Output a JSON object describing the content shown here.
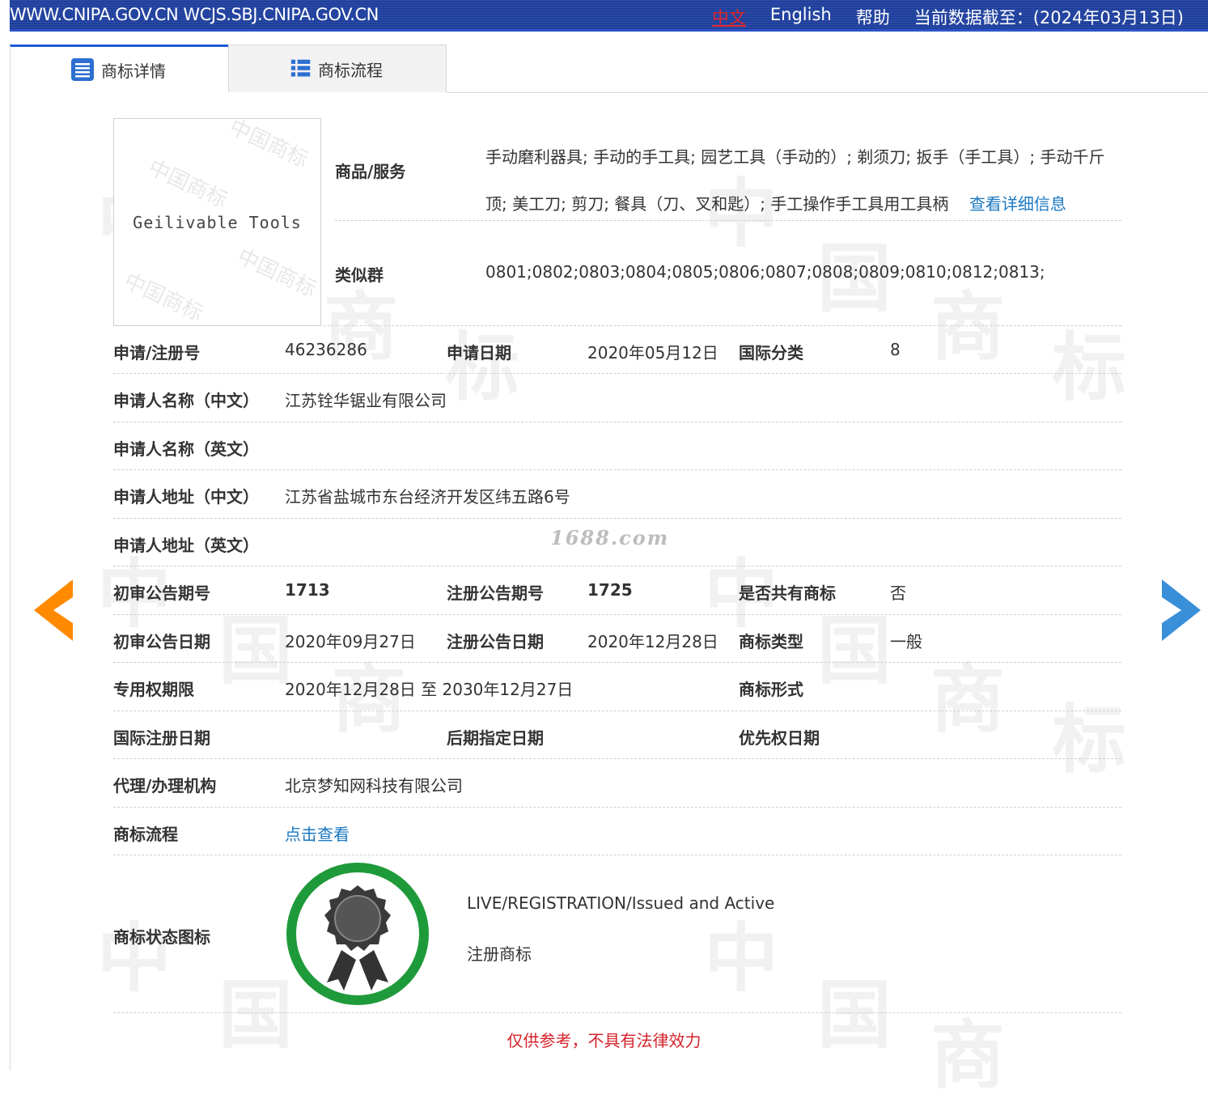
{
  "topbar": {
    "domains": "WWW.CNIPA.GOV.CN WCJS.SBJ.CNIPA.GOV.CN",
    "lang_zh": "中文",
    "lang_en": "English",
    "help": "帮助",
    "data_as_of": "当前数据截至：(2024年03月13日)"
  },
  "tabs": [
    {
      "label": "商标详情",
      "active": true,
      "icon": "document-list-icon"
    },
    {
      "label": "商标流程",
      "active": false,
      "icon": "list-icon"
    }
  ],
  "mark": {
    "image_text": "Geilivable Tools",
    "stamp_text": "中国商标"
  },
  "goods": {
    "label": "商品/服务",
    "text": "手动磨利器具; 手动的手工具; 园艺工具（手动的）; 剃须刀; 扳手（手工具）; 手动千斤顶; 美工刀; 剪刀; 餐具（刀、叉和匙）; 手工操作手工具用工具柄",
    "more_link": "查看详细信息"
  },
  "similar_groups": {
    "label": "类似群",
    "value": "0801;0802;0803;0804;0805;0806;0807;0808;0809;0810;0812;0813;"
  },
  "fields": {
    "reg_no_label": "申请/注册号",
    "reg_no": "46236286",
    "app_date_label": "申请日期",
    "app_date": "2020年05月12日",
    "intl_class_label": "国际分类",
    "intl_class": "8",
    "applicant_cn_label": "申请人名称（中文）",
    "applicant_cn": "江苏铨华锯业有限公司",
    "applicant_en_label": "申请人名称（英文）",
    "applicant_en": "",
    "address_cn_label": "申请人地址（中文）",
    "address_cn": "江苏省盐城市东台经济开发区纬五路6号",
    "address_en_label": "申请人地址（英文）",
    "address_en": "",
    "prelim_issue_label": "初审公告期号",
    "prelim_issue": "1713",
    "reg_issue_label": "注册公告期号",
    "reg_issue": "1725",
    "shared_label": "是否共有商标",
    "shared": "否",
    "prelim_date_label": "初审公告日期",
    "prelim_date": "2020年09月27日",
    "reg_date_label": "注册公告日期",
    "reg_date": "2020年12月28日",
    "mark_type_label": "商标类型",
    "mark_type": "一般",
    "exclusive_label": "专用权期限",
    "exclusive": "2020年12月28日 至 2030年12月27日",
    "mark_form_label": "商标形式",
    "mark_form": "",
    "intl_reg_date_label": "国际注册日期",
    "later_designation_label": "后期指定日期",
    "priority_date_label": "优先权日期",
    "agent_label": "代理/办理机构",
    "agent": "北京梦知网科技有限公司",
    "process_label": "商标流程",
    "process_link": "点击查看",
    "status_icon_label": "商标状态图标",
    "status_en": "LIVE/REGISTRATION/Issued and Active",
    "status_cn": "注册商标"
  },
  "watermark_text": "1688.com",
  "disclaimer": "仅供参考，不具有法律效力",
  "colors": {
    "topbar": "#1e3f9d",
    "link": "#1a78c2",
    "prev_arrow": "#ff8a00",
    "next_arrow": "#3a8fd9",
    "badge_ring": "#1f9a3a",
    "disclaimer": "#d4222a"
  }
}
